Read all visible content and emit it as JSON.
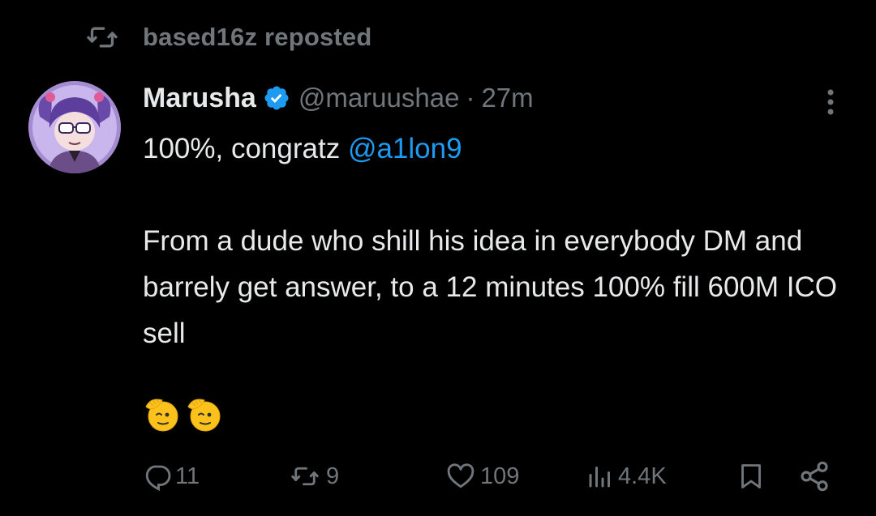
{
  "repost": {
    "label": "based16z reposted",
    "icon": "repost-icon"
  },
  "tweet": {
    "author_name": "Marusha",
    "verified": true,
    "handle": "@maruushae",
    "separator": "·",
    "time": "27m",
    "text": {
      "line1_prefix": "100%, congratz ",
      "mention": "@a1lon9",
      "paragraph2": "From a dude who shill his idea in everybody DM and barrely get answer, to a 12 minutes 100% fill 600M ICO sell",
      "emojis": [
        "saluting-face-emoji",
        "saluting-face-emoji"
      ]
    }
  },
  "actions": {
    "replies": "11",
    "reposts": "9",
    "likes": "109",
    "views": "4.4K"
  },
  "colors": {
    "background": "#000000",
    "text": "#e7e9ea",
    "muted": "#71767b",
    "accent": "#1d9bf0"
  }
}
